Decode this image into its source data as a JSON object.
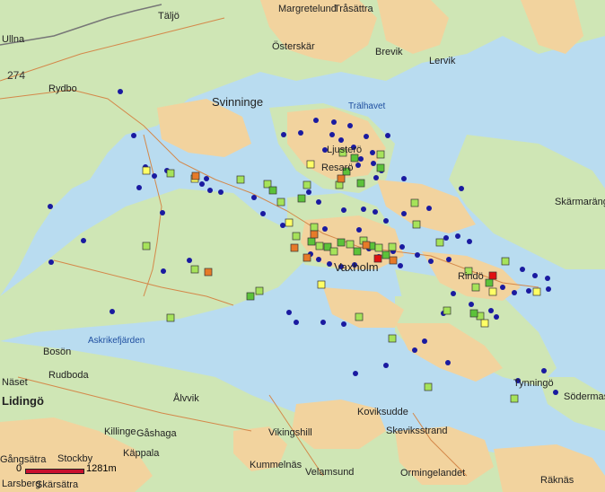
{
  "map": {
    "colors": {
      "water": "#b9dcf0",
      "land": "#cfe6b5",
      "urban": "#f2d39e",
      "road": "#d4884a",
      "marker_blue": "#1a1aa0",
      "marker_lightgreen": "#a6e35a",
      "marker_green": "#5cc23a",
      "marker_yellow": "#ffff66",
      "marker_orange": "#e67a28",
      "marker_red": "#e01010"
    },
    "places": [
      {
        "name": "Täljö",
        "style": ""
      },
      {
        "name": "Margretelund",
        "style": ""
      },
      {
        "name": "Tråsättra",
        "style": ""
      },
      {
        "name": "Ullna",
        "style": ""
      },
      {
        "name": "Österskär",
        "style": ""
      },
      {
        "name": "Brevik",
        "style": ""
      },
      {
        "name": "Lervik",
        "style": ""
      },
      {
        "name": "274",
        "style": "road"
      },
      {
        "name": "Rydbo",
        "style": ""
      },
      {
        "name": "Svinninge",
        "style": "big"
      },
      {
        "name": "Trälhavet",
        "style": "water"
      },
      {
        "name": "Skärmarängen",
        "style": ""
      },
      {
        "name": "Askrikefjärden",
        "style": "water"
      },
      {
        "name": "Bosön",
        "style": ""
      },
      {
        "name": "Näset",
        "style": ""
      },
      {
        "name": "Rudboda",
        "style": ""
      },
      {
        "name": "Lidingö",
        "style": "bold"
      },
      {
        "name": "Ålvvik",
        "style": ""
      },
      {
        "name": "Tynningö",
        "style": ""
      },
      {
        "name": "Södermas",
        "style": ""
      },
      {
        "name": "Koviksudde",
        "style": ""
      },
      {
        "name": "Skeviksstrand",
        "style": ""
      },
      {
        "name": "Vikingshill",
        "style": ""
      },
      {
        "name": "Killinge",
        "style": ""
      },
      {
        "name": "Gåshaga",
        "style": ""
      },
      {
        "name": "Käppala",
        "style": ""
      },
      {
        "name": "Gångsätra",
        "style": ""
      },
      {
        "name": "Stockby",
        "style": ""
      },
      {
        "name": "Larsberg",
        "style": ""
      },
      {
        "name": "Skärsätra",
        "style": ""
      },
      {
        "name": "Kummelnäs",
        "style": ""
      },
      {
        "name": "Velamsund",
        "style": ""
      },
      {
        "name": "Ormingelandet",
        "style": ""
      },
      {
        "name": "Räknäs",
        "style": ""
      },
      {
        "name": "Vaxholm",
        "style": "big"
      },
      {
        "name": "Rindö",
        "style": ""
      },
      {
        "name": "Resarö",
        "style": ""
      },
      {
        "name": "Ljusterö",
        "style": ""
      }
    ],
    "scale": {
      "zero": "0",
      "max": "1281m"
    }
  }
}
